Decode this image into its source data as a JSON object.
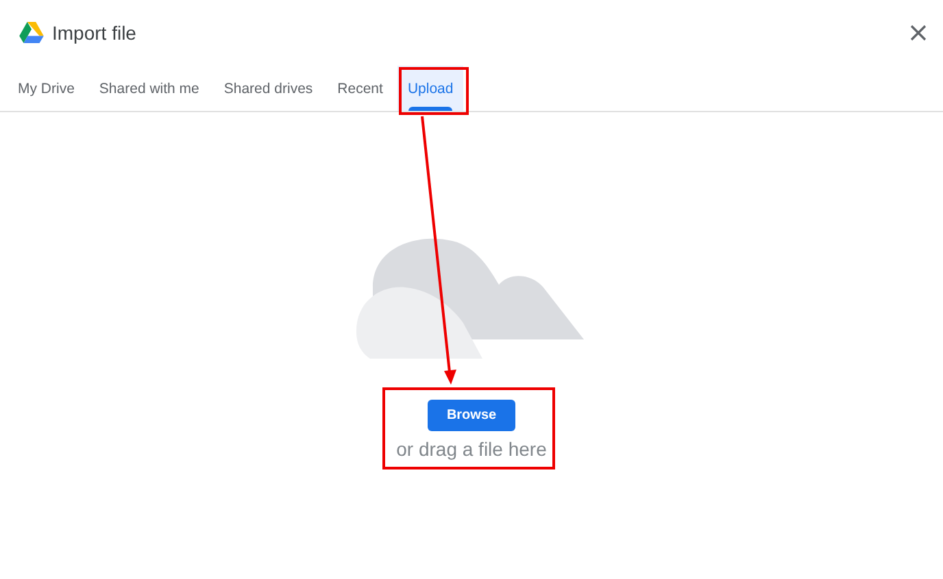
{
  "window": {
    "title": "Import file"
  },
  "tabs": [
    {
      "label": "My Drive",
      "selected": false
    },
    {
      "label": "Shared with me",
      "selected": false
    },
    {
      "label": "Shared drives",
      "selected": false
    },
    {
      "label": "Recent",
      "selected": false
    },
    {
      "label": "Upload",
      "selected": true
    }
  ],
  "upload": {
    "button": "Browse",
    "hint": "or drag a file here"
  }
}
